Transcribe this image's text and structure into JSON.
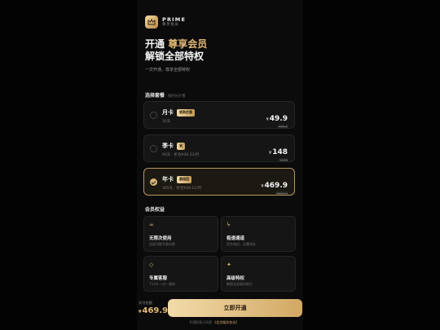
{
  "brand": {
    "name": "PRIME",
    "sub": "尊享会员"
  },
  "hero": {
    "line1_a": "开通 ",
    "line1_b": "尊享会员",
    "line2": "解锁全部特权",
    "sub": "一次开通，尊享全部特权"
  },
  "plans": {
    "title": "选择套餐",
    "title_sub": "按时长计费",
    "items": [
      {
        "name": "月卡",
        "badge": "首购优惠",
        "desc": "30天",
        "currency": "¥",
        "price": "49.9",
        "orig": "¥69.9"
      },
      {
        "name": "季卡",
        "badge": "省",
        "desc": "90天 · 折合¥49.33/月",
        "currency": "¥",
        "price": "148",
        "orig": "¥198"
      },
      {
        "name": "年卡",
        "badge": "最超值",
        "desc": "365天 · 折合¥39.12/月",
        "currency": "¥",
        "price": "469.9",
        "orig": "¥699.9"
      }
    ]
  },
  "benefits": {
    "title": "会员权益",
    "items": [
      {
        "icon": "infinity-icon",
        "glyph": "∞",
        "title": "无限次使用",
        "desc": "全部功能不限次数"
      },
      {
        "icon": "lightning-icon",
        "glyph": "ϟ",
        "title": "极速通道",
        "desc": "优先响应，无需排队"
      },
      {
        "icon": "shield-icon",
        "glyph": "◇",
        "title": "专属客服",
        "desc": "7×24 一对一服务"
      },
      {
        "icon": "sparkle-icon",
        "glyph": "✦",
        "title": "高级特权",
        "desc": "解锁全部高阶能力"
      }
    ]
  },
  "footer": {
    "pay_label": "实付金额",
    "currency": "¥",
    "pay_price": "469.9",
    "cta": "立即开通",
    "agree_prefix": "开通即表示同意",
    "agree_link": "《会员服务协议》"
  },
  "colors": {
    "accent": "#d9b574",
    "background": "#0b0b0b"
  }
}
